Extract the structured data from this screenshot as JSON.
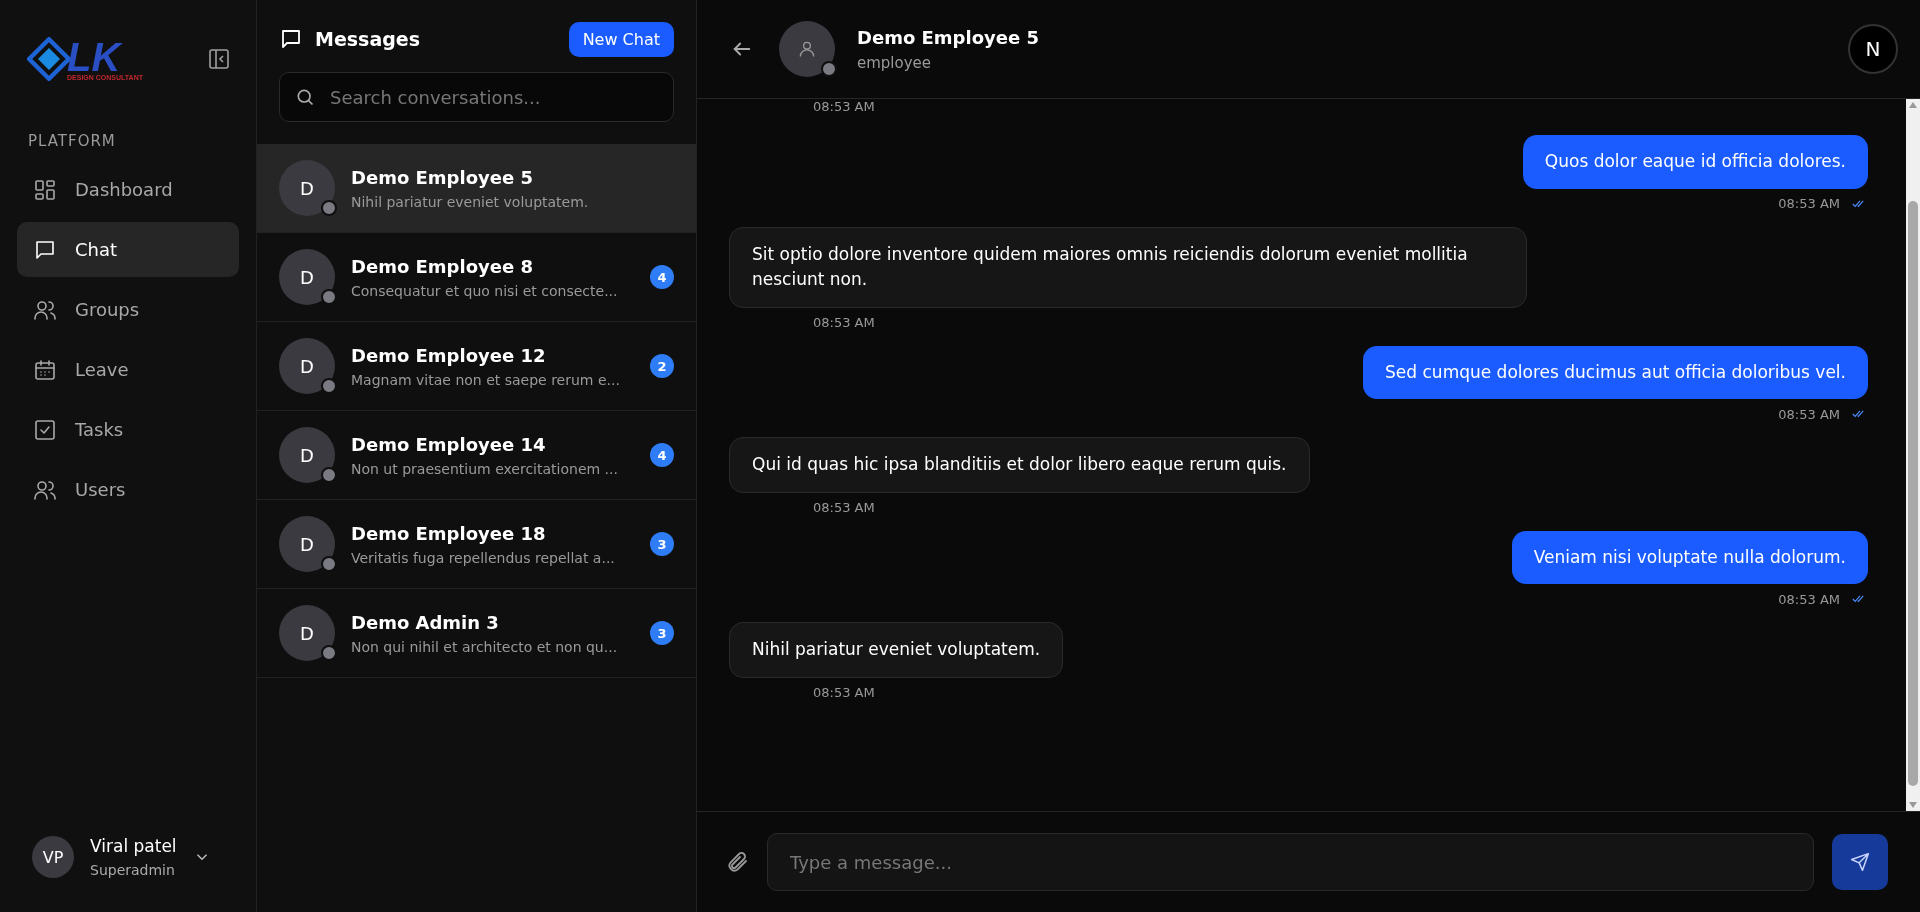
{
  "logo": {
    "mark": "LK",
    "tagline": "DESIGN CONSULTANT"
  },
  "sidebar": {
    "section": "PLATFORM",
    "items": [
      {
        "label": "Dashboard",
        "selected": false
      },
      {
        "label": "Chat",
        "selected": true
      },
      {
        "label": "Groups",
        "selected": false
      },
      {
        "label": "Leave",
        "selected": false
      },
      {
        "label": "Tasks",
        "selected": false
      },
      {
        "label": "Users",
        "selected": false
      }
    ],
    "user": {
      "initials": "VP",
      "name": "Viral patel",
      "role": "Superadmin"
    }
  },
  "messages_panel": {
    "title": "Messages",
    "new_button": "New Chat",
    "search": {
      "placeholder": "Search conversations..."
    },
    "conversations": [
      {
        "initial": "D",
        "name": "Demo Employee 5",
        "preview": "Nihil pariatur eveniet voluptatem.",
        "online": false,
        "selected": true
      },
      {
        "initial": "D",
        "name": "Demo Employee 8",
        "preview": "Consequatur et quo nisi et consecte...",
        "unread": "4",
        "online": false,
        "selected": false
      },
      {
        "initial": "D",
        "name": "Demo Employee 12",
        "preview": "Magnam vitae non et saepe rerum e...",
        "unread": "2",
        "online": false,
        "selected": false
      },
      {
        "initial": "D",
        "name": "Demo Employee 14",
        "preview": "Non ut praesentium exercitationem ...",
        "unread": "4",
        "online": false,
        "selected": false
      },
      {
        "initial": "D",
        "name": "Demo Employee 18",
        "preview": "Veritatis fuga repellendus repellat a...",
        "unread": "3",
        "online": false,
        "selected": false
      },
      {
        "initial": "D",
        "name": "Demo Admin 3",
        "preview": "Non qui nihil et architecto et non qu...",
        "unread": "3",
        "online": false,
        "selected": false
      }
    ]
  },
  "chat": {
    "contact": {
      "name": "Demo Employee 5",
      "role": "employee",
      "online": false
    },
    "corner_badge": "N",
    "partial_time": "08:53 AM",
    "messages": [
      {
        "kind": "sent",
        "text": "Quos dolor eaque id officia dolores.",
        "time": "08:53 AM",
        "read": true
      },
      {
        "kind": "received",
        "text": "Sit optio dolore inventore quidem maiores omnis reiciendis dolorum eveniet mollitia nesciunt non.",
        "time": "08:53 AM"
      },
      {
        "kind": "sent",
        "text": "Sed cumque dolores ducimus aut officia doloribus vel.",
        "time": "08:53 AM",
        "read": true
      },
      {
        "kind": "received",
        "text": "Qui id quas hic ipsa blanditiis et dolor libero eaque rerum quis.",
        "time": "08:53 AM"
      },
      {
        "kind": "sent",
        "text": "Veniam nisi voluptate nulla dolorum.",
        "time": "08:53 AM",
        "read": true
      },
      {
        "kind": "received",
        "text": "Nihil pariatur eveniet voluptatem.",
        "time": "08:53 AM"
      }
    ],
    "composer": {
      "placeholder": "Type a message..."
    }
  }
}
